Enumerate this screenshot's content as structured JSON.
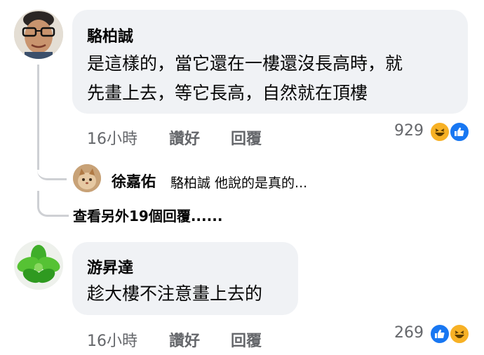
{
  "comments": [
    {
      "author": "駱柏誠",
      "lines": [
        "是這樣的，當它還在一樓還沒長高時，就",
        "先畫上去，等它長高，自然就在頂樓"
      ],
      "time": "16小時",
      "like_label": "讚好",
      "reply_label": "回覆",
      "reaction_count": "929",
      "reactions": [
        "haha-icon",
        "like-icon"
      ]
    },
    {
      "author": "游昇達",
      "lines": [
        "趁大樓不注意畫上去的"
      ],
      "time": "16小時",
      "like_label": "讚好",
      "reply_label": "回覆",
      "reaction_count": "269",
      "reactions": [
        "like-icon",
        "haha-icon"
      ]
    }
  ],
  "reply_preview": {
    "author": "徐嘉佑",
    "text": "駱柏誠 他說的是真的..."
  },
  "more_replies_label": "查看另外19個回覆......",
  "colors": {
    "bubble": "#f0f2f5",
    "meta_text": "#65676b",
    "like_blue": "#1877f2",
    "haha_yellow": "#f7b125",
    "thread_line": "#ced0d4"
  }
}
